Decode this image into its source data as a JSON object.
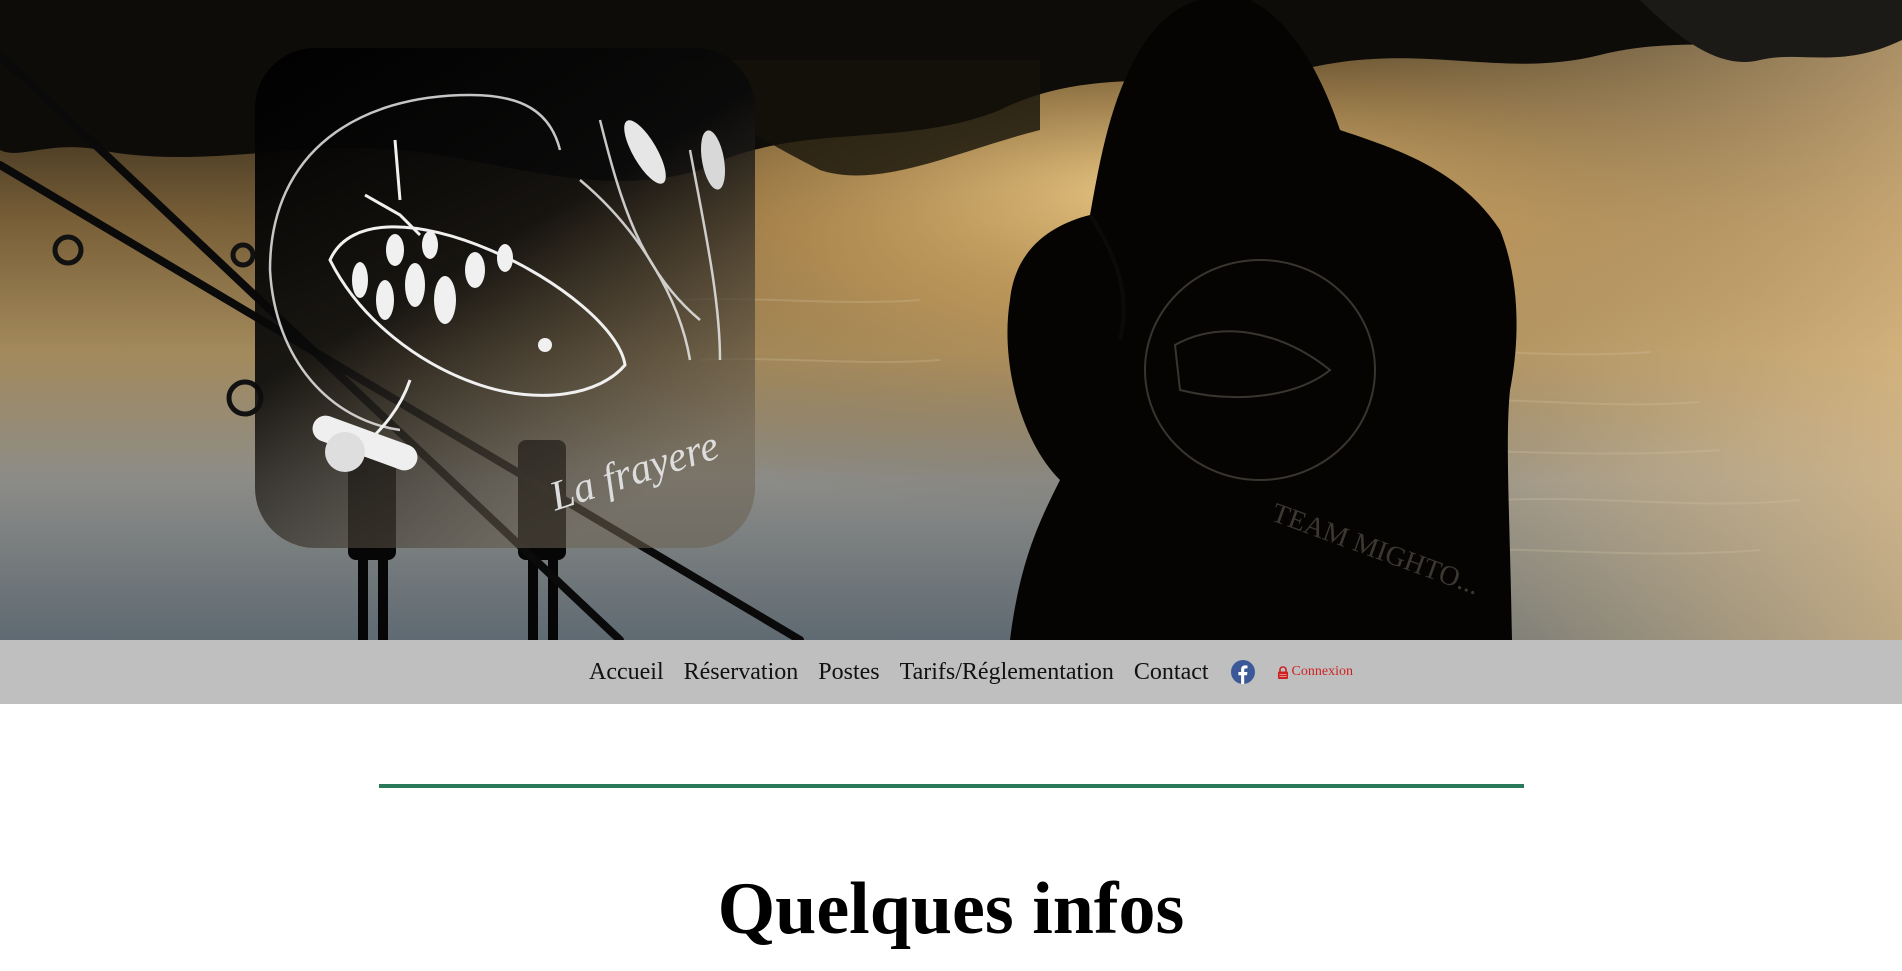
{
  "hero": {
    "logo_text": "La frayere",
    "hoodie_text": "TEAM MIGHTO...",
    "image_description": "Silhouette of an angler in a hoodie sitting by a lake at sunset with carp fishing rods and bite alarms"
  },
  "nav": {
    "items": [
      {
        "label": "Accueil"
      },
      {
        "label": "Réservation"
      },
      {
        "label": "Postes"
      },
      {
        "label": "Tarifs/Réglementation"
      },
      {
        "label": "Contact"
      }
    ],
    "facebook_icon": "facebook-icon",
    "login_icon": "lock-icon",
    "login_label": "Connexion"
  },
  "main": {
    "section_title": "Quelques infos"
  },
  "colors": {
    "nav_background": "#c0bfc0",
    "nav_text": "#111111",
    "facebook_blue": "#3b5998",
    "login_red": "#cc2222",
    "divider_green": "#2a7a5a",
    "page_background": "#ffffff"
  }
}
